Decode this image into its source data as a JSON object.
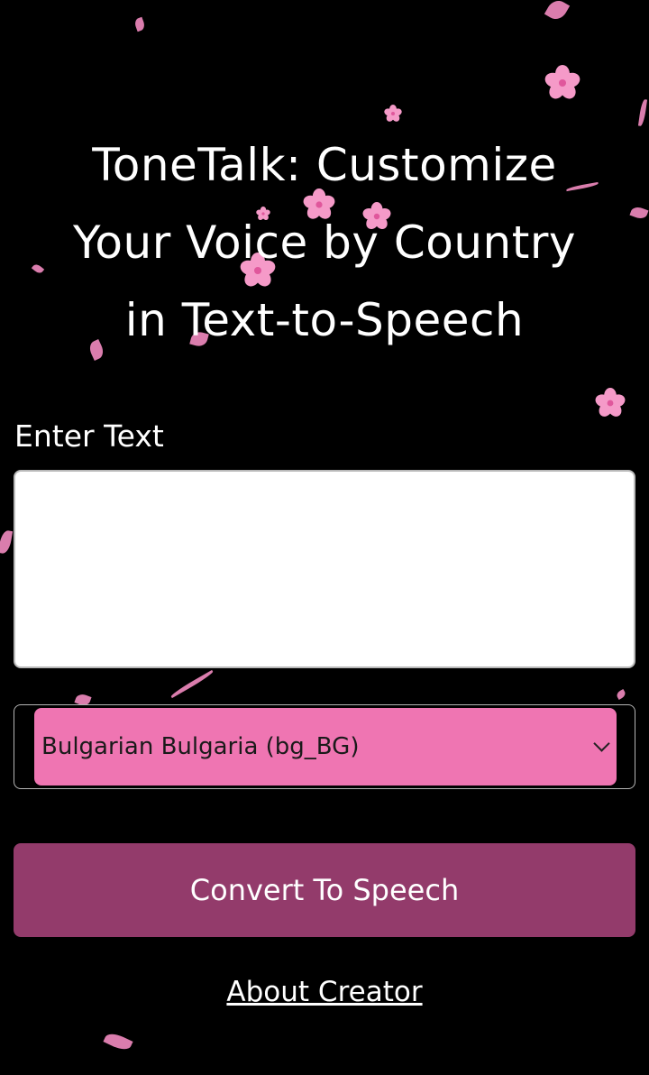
{
  "title": {
    "line1": "ToneTalk: Customize",
    "line2": "Your Voice by Country",
    "line3": "in Text-to-Speech"
  },
  "form": {
    "text_label": "Enter Text",
    "text_value": "",
    "language_selected": "Bulgarian Bulgaria (bg_BG)",
    "convert_label": "Convert To Speech"
  },
  "footer": {
    "about_link": "About Creator"
  },
  "colors": {
    "background": "#000000",
    "select_fill": "#ef75b2",
    "button_fill": "#933b6b",
    "petal": "#f28bc0"
  }
}
